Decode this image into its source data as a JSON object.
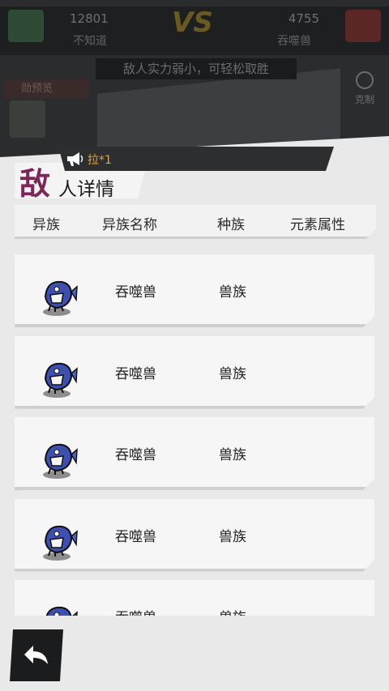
{
  "battle": {
    "left_power": "12801",
    "left_name": "不知道",
    "vs": "VS",
    "right_power": "4755",
    "right_name": "吞噬兽",
    "hint": "敌人实力弱小，可轻松取胜",
    "preview_label": "勋预览",
    "share_label": "克制"
  },
  "ticker": {
    "text": "拉*1"
  },
  "title": {
    "first_char": "敌",
    "rest": "人详情"
  },
  "table": {
    "headers": [
      "异族",
      "异族名称",
      "种族",
      "元素属性"
    ],
    "rows": [
      {
        "name": "吞噬兽",
        "race": "兽族",
        "element": "",
        "icon": "fish-monster-icon"
      },
      {
        "name": "吞噬兽",
        "race": "兽族",
        "element": "",
        "icon": "fish-monster-icon"
      },
      {
        "name": "吞噬兽",
        "race": "兽族",
        "element": "",
        "icon": "fish-monster-icon"
      },
      {
        "name": "吞噬兽",
        "race": "兽族",
        "element": "",
        "icon": "fish-monster-icon"
      },
      {
        "name": "吞噬兽",
        "race": "兽族",
        "element": "",
        "icon": "fish-monster-icon"
      }
    ]
  },
  "colors": {
    "title_accent": "#7c2758",
    "ticker": "#f0a61d",
    "panel_bg": "#e9e9e9"
  },
  "back_button": {
    "icon": "back-arrow-icon"
  }
}
